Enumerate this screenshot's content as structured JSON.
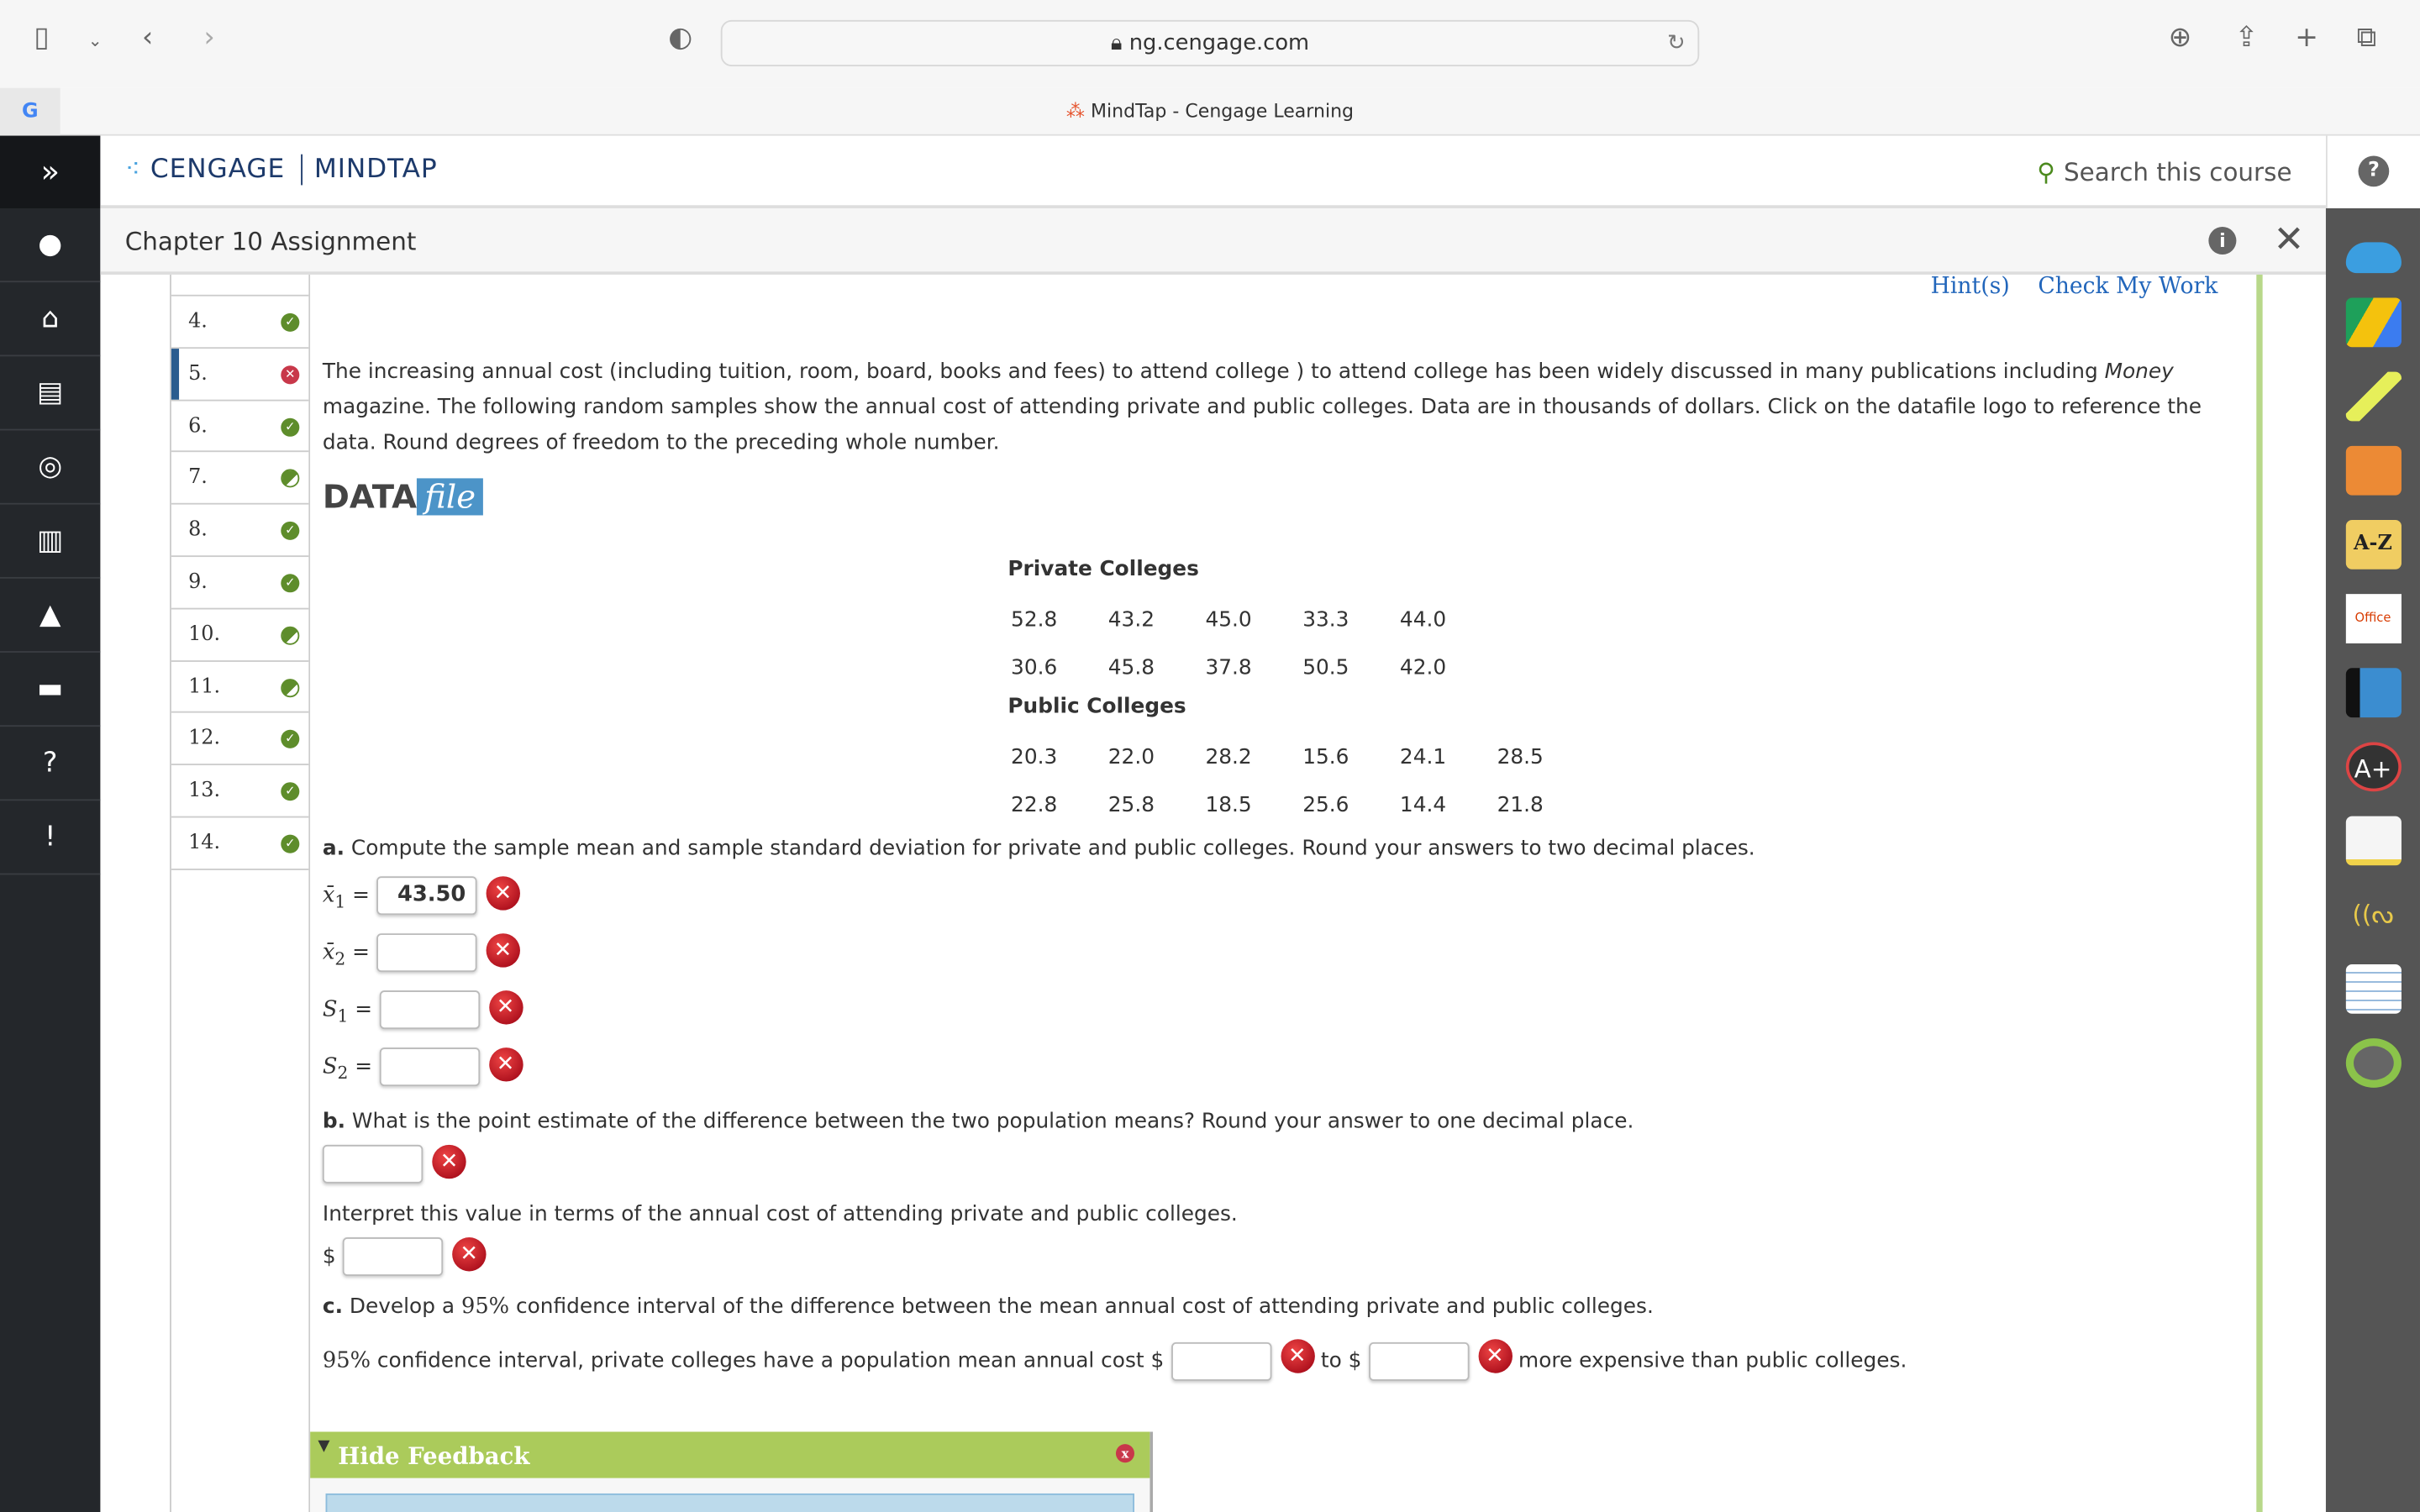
{
  "browser": {
    "url": "ng.cengage.com",
    "tab_title": "MindTap - Cengage Learning"
  },
  "header": {
    "logo_brand": "CENGAGE",
    "logo_product": "MINDTAP",
    "search_label": "Search this course",
    "help": "?"
  },
  "title_bar": {
    "title": "Chapter 10 Assignment"
  },
  "questions": [
    {
      "num": "4.",
      "status": "correct"
    },
    {
      "num": "5.",
      "status": "incorrect",
      "current": true
    },
    {
      "num": "6.",
      "status": "correct"
    },
    {
      "num": "7.",
      "status": "partial"
    },
    {
      "num": "8.",
      "status": "correct"
    },
    {
      "num": "9.",
      "status": "correct"
    },
    {
      "num": "10.",
      "status": "partial"
    },
    {
      "num": "11.",
      "status": "partial"
    },
    {
      "num": "12.",
      "status": "correct"
    },
    {
      "num": "13.",
      "status": "correct"
    },
    {
      "num": "14.",
      "status": "correct"
    }
  ],
  "actions": {
    "hints": "Hint(s)",
    "check": "Check My Work"
  },
  "problem": {
    "intro_a": "The increasing annual cost (including tuition, room, board, books and fees) to attend college ) to attend college has been widely discussed in many publications including ",
    "intro_em": "Money",
    "intro_b": " magazine. The following random samples show the annual cost of attending private and public colleges. Data are in thousands of dollars. Click on the datafile logo to reference the data. Round degrees of freedom to the preceding whole number.",
    "datafile_a": "DATA",
    "datafile_b": "file",
    "private_label": "Private Colleges",
    "private": [
      [
        "52.8",
        "43.2",
        "45.0",
        "33.3",
        "44.0"
      ],
      [
        "30.6",
        "45.8",
        "37.8",
        "50.5",
        "42.0"
      ]
    ],
    "public_label": "Public Colleges",
    "public": [
      [
        "20.3",
        "22.0",
        "28.2",
        "15.6",
        "24.1",
        "28.5"
      ],
      [
        "22.8",
        "25.8",
        "18.5",
        "25.6",
        "14.4",
        "21.8"
      ]
    ],
    "a_bold": "a.",
    "a_text": " Compute the sample mean and sample standard deviation for private and public colleges. Round your answers to two decimal places.",
    "a_fields": [
      {
        "label": "x̄",
        "sub": "1",
        "value": "43.50"
      },
      {
        "label": "x̄",
        "sub": "2",
        "value": ""
      },
      {
        "label": "S",
        "sub": "1",
        "value": ""
      },
      {
        "label": "S",
        "sub": "2",
        "value": ""
      }
    ],
    "b_bold": "b.",
    "b_text": " What is the point estimate of the difference between the two population means? Round your answer to one decimal place.",
    "interpret": "Interpret this value in terms of the annual cost of attending private and public colleges.",
    "dollar": "$",
    "c_bold": "c.",
    "c_text_a": " Develop a ",
    "c_pct": "95%",
    "c_text_b": " confidence interval of the difference between the mean annual cost of attending private and public colleges.",
    "ci_pct": "95%",
    "ci_text_a": " confidence interval, private colleges have a population mean annual cost ",
    "ci_to": " to ",
    "ci_text_b": " more expensive than public colleges."
  },
  "feedback": {
    "title": "Hide Feedback",
    "color": "#abcb5b"
  },
  "colors": {
    "left_nav": "#24272b",
    "accent_link": "#2266bb",
    "incorrect": "#c8384a",
    "correct": "#5e8d2b"
  }
}
